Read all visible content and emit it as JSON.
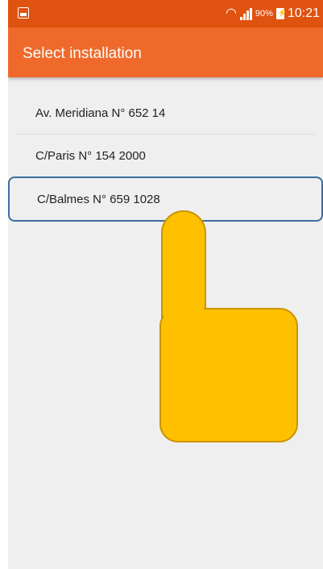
{
  "status_bar": {
    "battery": "90%",
    "time": "10:21"
  },
  "app_bar": {
    "title": "Select installation"
  },
  "installations": [
    {
      "label": "Av. Meridiana N° 652 14"
    },
    {
      "label": "C/Paris N° 154 2000"
    },
    {
      "label": "C/Balmes N° 659 1028"
    }
  ],
  "selected_index": 2,
  "colors": {
    "status_bar": "#e0520f",
    "app_bar": "#ef6a2a",
    "selection_border": "#3a6e9e",
    "pointer_fill": "#ffc000"
  }
}
